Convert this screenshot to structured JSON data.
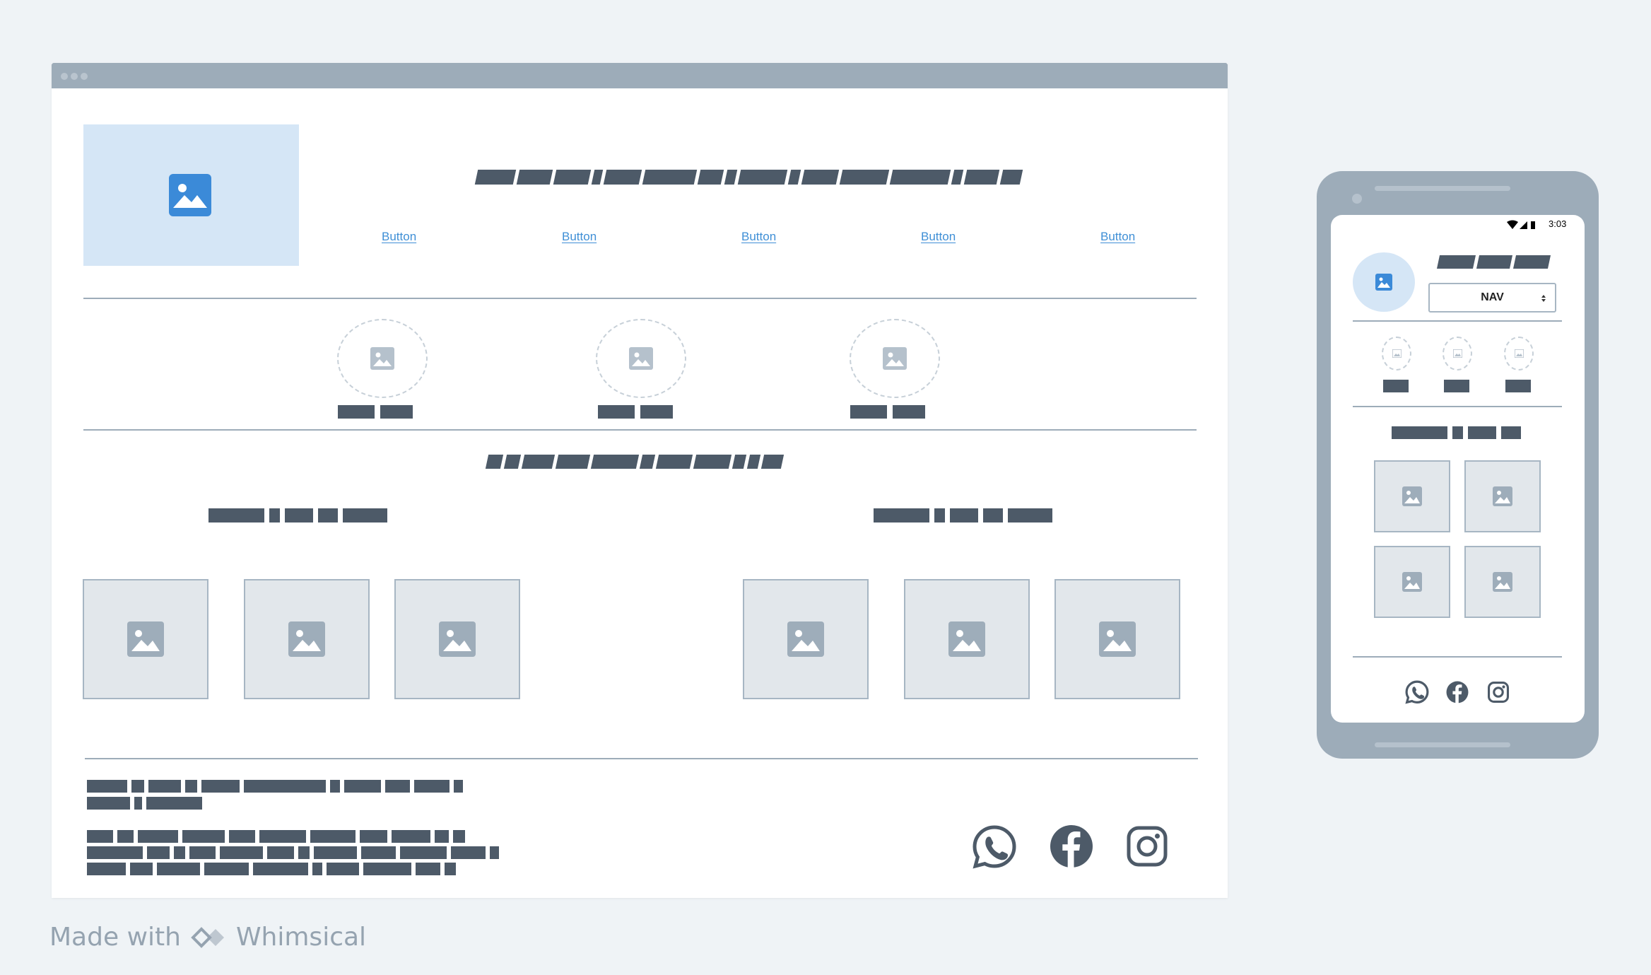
{
  "header": {
    "nav_buttons": [
      "Button",
      "Button",
      "Button",
      "Button",
      "Button"
    ]
  },
  "mobile": {
    "status_time": "3:03",
    "nav_select": "NAV"
  },
  "footer": {
    "social_icons": [
      "whatsapp-icon",
      "facebook-icon",
      "instagram-icon"
    ]
  },
  "watermark": {
    "prefix": "Made with",
    "brand": "Whimsical"
  },
  "colors": {
    "accent": "#3f8fd6",
    "text_block": "#4d5a68",
    "frame": "#9dacb9",
    "hero_bg": "#d5e6f6",
    "tile_bg": "#e2e7eb"
  }
}
